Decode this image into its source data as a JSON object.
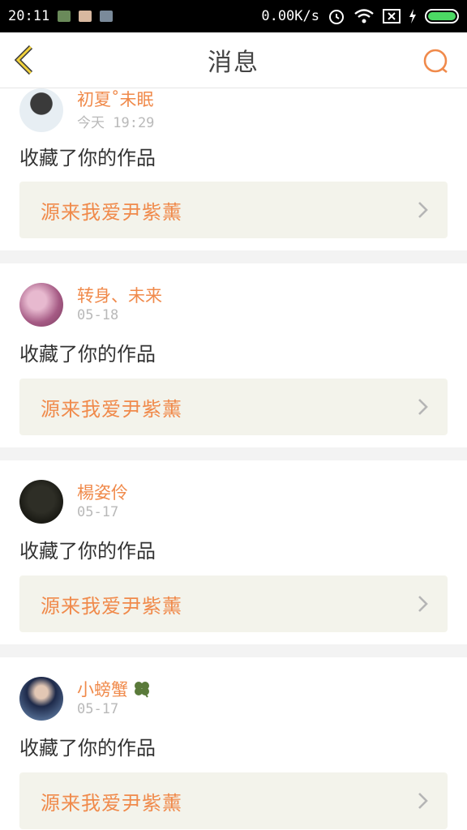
{
  "status_bar": {
    "time": "20:11",
    "speed": "0.00K/s",
    "icons": [
      "alarm-icon",
      "wifi-icon",
      "sim-icon",
      "charging-icon",
      "battery-icon"
    ]
  },
  "header": {
    "title": "消息",
    "back_icon": "back-chevron-icon",
    "search_icon": "search-icon",
    "accent": "#f08a4b"
  },
  "messages": [
    {
      "user": "初夏˚未眠",
      "time": "今天 19:29",
      "action": "收藏了你的作品",
      "work": "源来我爱尹紫薰"
    },
    {
      "user": "转身、未来",
      "time": "05-18",
      "action": "收藏了你的作品",
      "work": "源来我爱尹紫薰"
    },
    {
      "user": "楊姿伶",
      "time": "05-17",
      "action": "收藏了你的作品",
      "work": "源来我爱尹紫薰"
    },
    {
      "user": "小螃蟹",
      "time": "05-17",
      "action": "收藏了你的作品",
      "work": "源来我爱尹紫薰",
      "user_badge": "clover-icon"
    }
  ]
}
